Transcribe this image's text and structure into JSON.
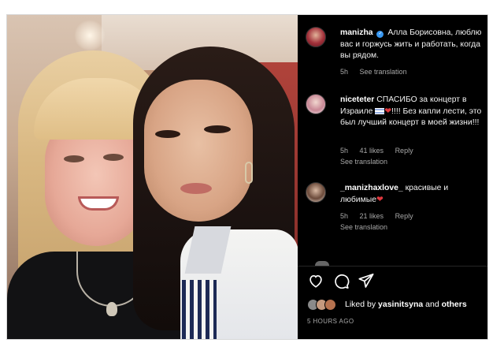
{
  "post": {
    "caption": {
      "username": "manizha",
      "text": "Алла Борисовна, люблю вас и горжусь жить и работать, когда вы рядом.",
      "time": "5h",
      "see_translation": "See translation"
    },
    "comments": [
      {
        "username": "niceteter",
        "text_before": "СПАСИБО за концерт в Израиле ",
        "text_after": "!!!! Без капли лести, это был лучший концерт в моей жизни!!!",
        "time": "5h",
        "likes": "41 likes",
        "reply": "Reply",
        "see_translation": "See translation"
      },
      {
        "username": "_manizhaxlove_",
        "text": "красивые и любимые",
        "time": "5h",
        "likes": "21 likes",
        "reply": "Reply",
        "see_translation": "See translation"
      }
    ],
    "likes_line": {
      "prefix": "Liked by",
      "user": "yasinitsyna",
      "middle": "and",
      "others": "others"
    },
    "timestamp": "5 HOURS AGO"
  },
  "icons": [
    "verified-badge-icon",
    "heart-icon",
    "comment-icon",
    "share-icon",
    "israel-flag-icon"
  ],
  "colors": {
    "background": "#000000",
    "text": "#ffffff",
    "muted": "#a8a8a8",
    "verified": "#3897f0",
    "heart": "#e0383e"
  }
}
